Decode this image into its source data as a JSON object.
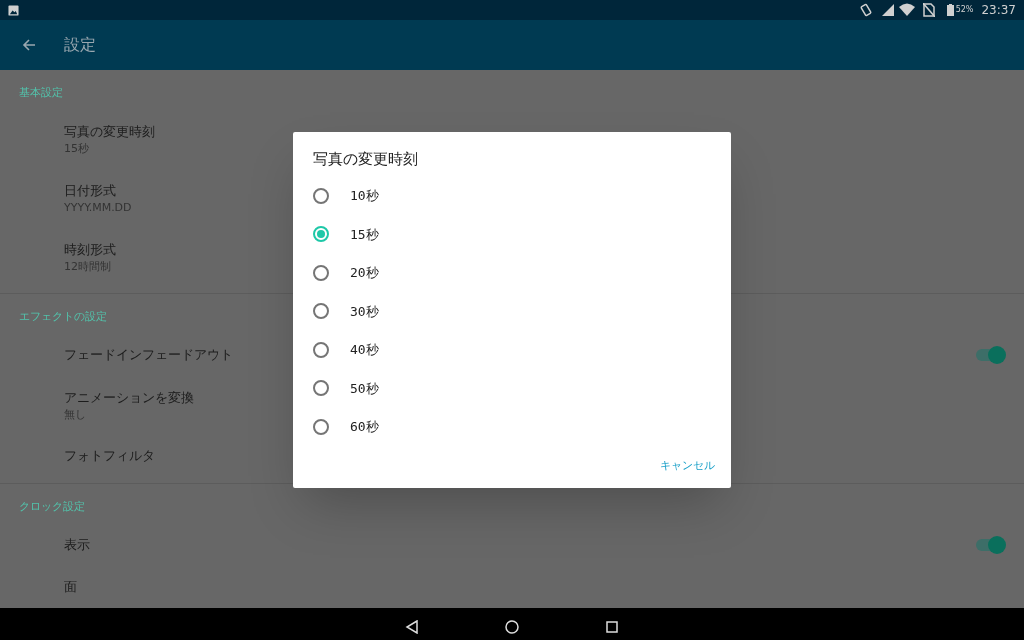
{
  "status_bar": {
    "battery": "52%",
    "time": "23:37"
  },
  "app_bar": {
    "title": "設定"
  },
  "sections": [
    {
      "header": "基本設定",
      "items": [
        {
          "kind": "text",
          "title": "写真の変更時刻",
          "summary": "15秒"
        },
        {
          "kind": "text",
          "title": "日付形式",
          "summary": "YYYY.MM.DD"
        },
        {
          "kind": "text",
          "title": "時刻形式",
          "summary": "12時間制"
        }
      ]
    },
    {
      "header": "エフェクトの設定",
      "items": [
        {
          "kind": "switch",
          "title": "フェードインフェードアウト",
          "on": true
        },
        {
          "kind": "text",
          "title": "アニメーションを変換",
          "summary": "無し"
        },
        {
          "kind": "text",
          "title": "フォトフィルタ"
        }
      ]
    },
    {
      "header": "クロック設定",
      "items": [
        {
          "kind": "switch",
          "title": "表示",
          "on": true
        },
        {
          "kind": "text",
          "title": "面"
        }
      ]
    }
  ],
  "dialog": {
    "title": "写真の変更時刻",
    "options": [
      {
        "label": "10秒",
        "selected": false
      },
      {
        "label": "15秒",
        "selected": true
      },
      {
        "label": "20秒",
        "selected": false
      },
      {
        "label": "30秒",
        "selected": false
      },
      {
        "label": "40秒",
        "selected": false
      },
      {
        "label": "50秒",
        "selected": false
      },
      {
        "label": "60秒",
        "selected": false
      }
    ],
    "buttons": [
      "キャンセル"
    ]
  }
}
